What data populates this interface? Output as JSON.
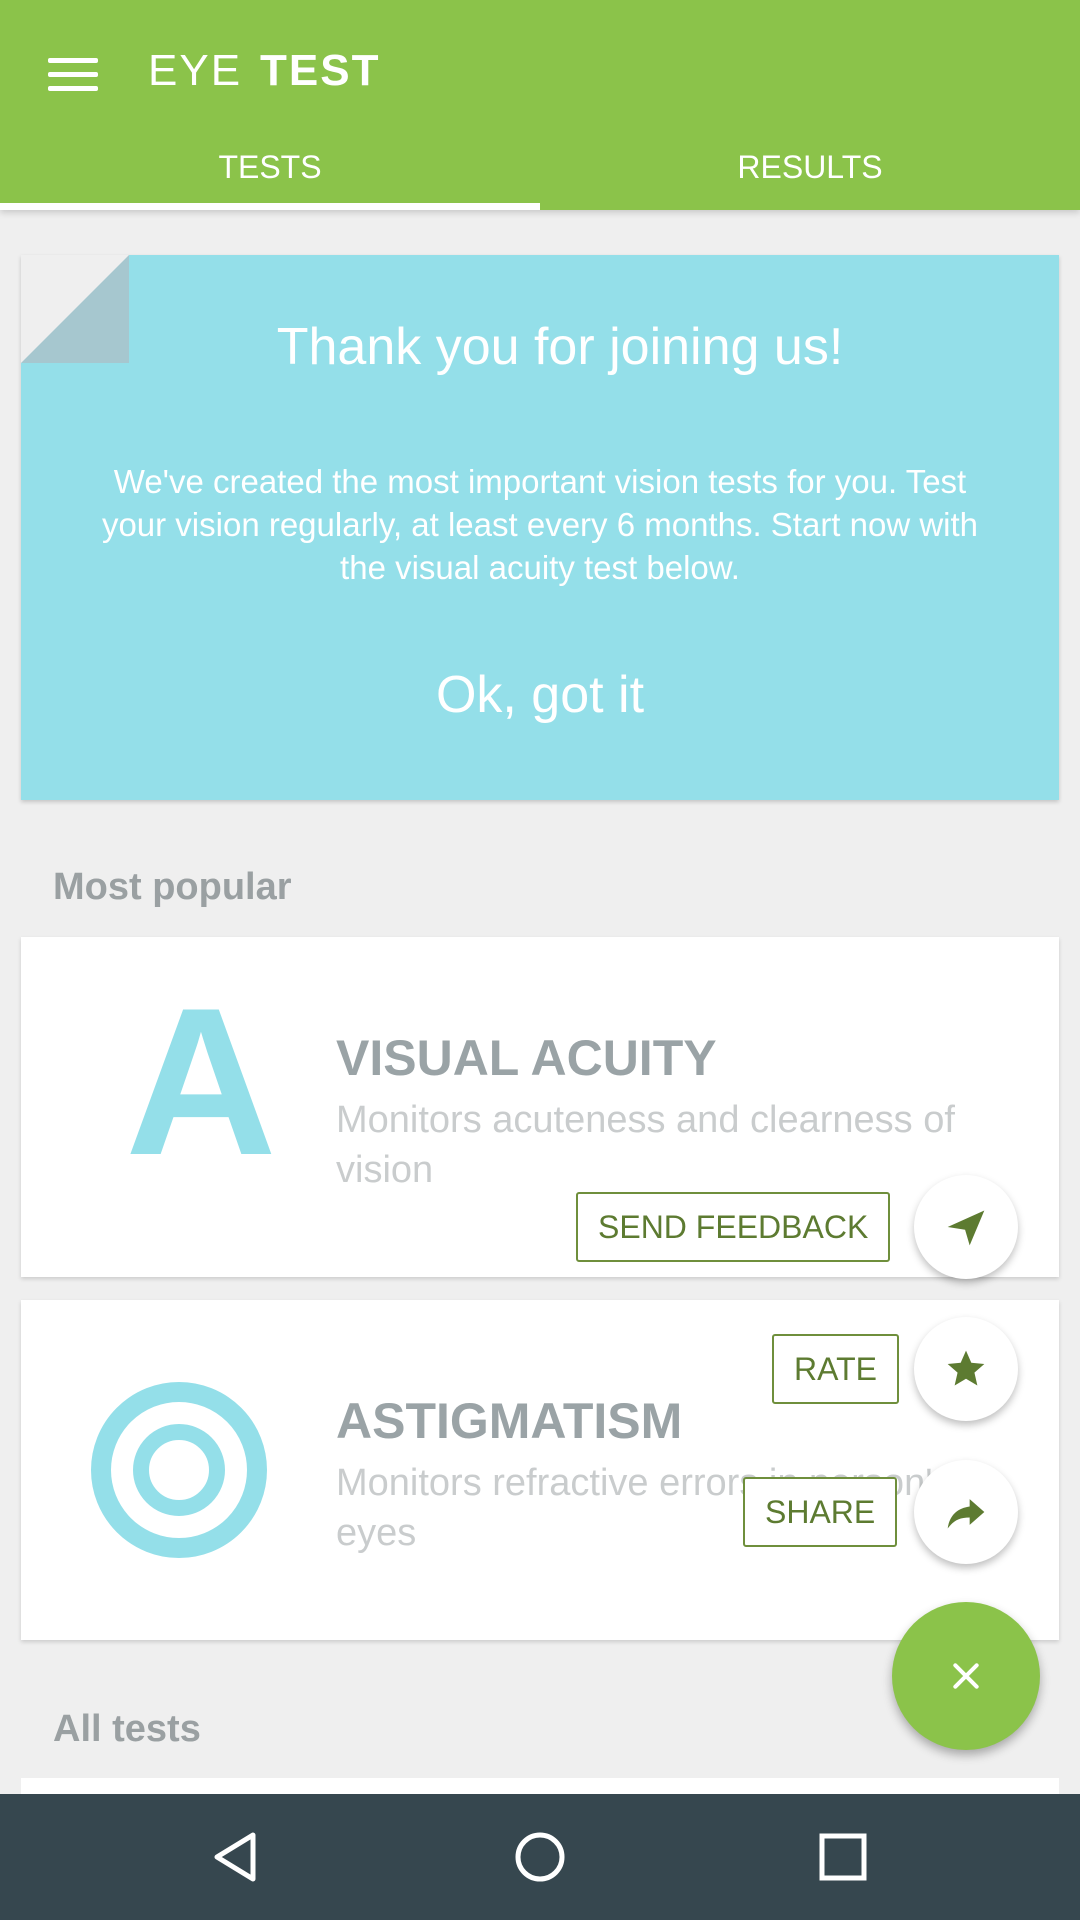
{
  "app": {
    "title_light": "EYE",
    "title_bold": "TEST",
    "primary_color": "#8bc34a",
    "accent_color": "#94dfe9"
  },
  "tabs": [
    {
      "label": "TESTS",
      "selected": true
    },
    {
      "label": "RESULTS",
      "selected": false
    }
  ],
  "intro": {
    "title": "Thank you for joining us!",
    "body": "We've created the most important vision tests for you. Test your vision regularly, at least every 6 months. Start now with the visual acuity test below.",
    "ok_label": "Ok, got it"
  },
  "sections": {
    "most_popular": "Most popular",
    "all_tests": "All tests"
  },
  "tests": [
    {
      "icon_letter": "A",
      "title": "VISUAL ACUITY",
      "description": "Monitors acuteness and clearness of vision"
    },
    {
      "icon": "target-icon",
      "title": "ASTIGMATISM",
      "description": "Monitors refractive errors in person's eyes"
    }
  ],
  "speed_dial": {
    "send_feedback": "SEND FEEDBACK",
    "rate": "RATE",
    "share": "SHARE"
  },
  "navbar": {
    "icons": [
      "back-icon",
      "home-icon",
      "recents-icon"
    ]
  }
}
